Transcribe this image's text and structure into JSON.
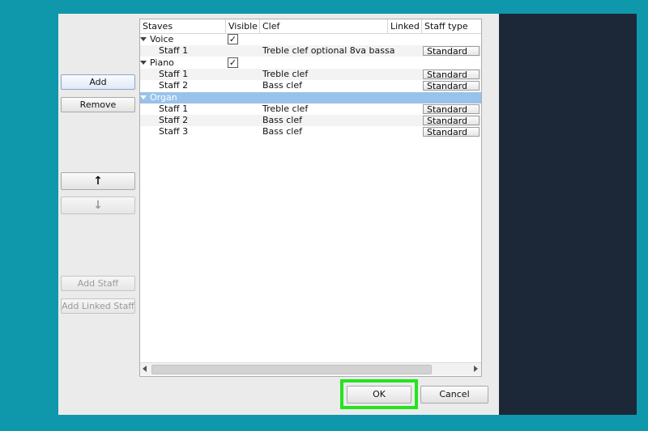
{
  "side_buttons": {
    "add": "Add",
    "remove": "Remove",
    "move_up": "↑",
    "move_down": "↓",
    "add_staff": "Add Staff",
    "add_linked_staff": "Add Linked Staff"
  },
  "columns": [
    "Staves",
    "Visible",
    "Clef",
    "Linked",
    "Staff type"
  ],
  "rows": [
    {
      "kind": "instrument",
      "name": "Voice",
      "visible": true,
      "clef": "",
      "staff_type": ""
    },
    {
      "kind": "staff",
      "name": "Staff 1",
      "visible": false,
      "clef": "Treble clef optional 8va bassa",
      "staff_type": "Standard"
    },
    {
      "kind": "instrument",
      "name": "Piano",
      "visible": true,
      "clef": "",
      "staff_type": ""
    },
    {
      "kind": "staff",
      "name": "Staff 1",
      "visible": false,
      "clef": "Treble clef",
      "staff_type": "Standard"
    },
    {
      "kind": "staff",
      "name": "Staff 2",
      "visible": false,
      "clef": "Bass clef",
      "staff_type": "Standard"
    },
    {
      "kind": "instrument",
      "name": "Organ",
      "visible": false,
      "selected": true,
      "clef": "",
      "staff_type": ""
    },
    {
      "kind": "staff",
      "name": "Staff 1",
      "visible": false,
      "clef": "Treble clef",
      "staff_type": "Standard"
    },
    {
      "kind": "staff",
      "name": "Staff 2",
      "visible": false,
      "clef": "Bass clef",
      "staff_type": "Standard"
    },
    {
      "kind": "staff",
      "name": "Staff 3",
      "visible": false,
      "clef": "Bass clef",
      "staff_type": "Standard"
    }
  ],
  "checkmark": "✓",
  "dialog_buttons": {
    "ok": "OK",
    "cancel": "Cancel"
  },
  "colors": {
    "background": "#0f97ac",
    "selection": "#99c2ea",
    "highlight": "#25e31f",
    "dark_panel": "#1c2838"
  }
}
